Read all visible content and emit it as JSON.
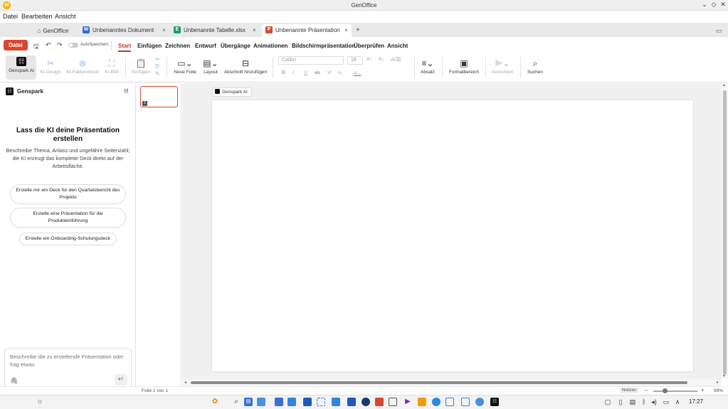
{
  "window": {
    "title": "GenOffice",
    "logo": "W",
    "controls": [
      "⌄",
      "◇",
      "✕"
    ]
  },
  "menubar": {
    "items": [
      "Datei",
      "Bearbeiten",
      "Ansicht"
    ]
  },
  "tabs": [
    {
      "label": "GenOffice",
      "icon": "home-icon",
      "glyph": "⌂"
    },
    {
      "label": "Unbenanntes Dokument",
      "icon": "word-icon",
      "glyph": "W",
      "color": "#2b6cd4"
    },
    {
      "label": "Unbenannte Tabelle.xlsx",
      "icon": "excel-icon",
      "glyph": "E",
      "color": "#1e9e5a"
    },
    {
      "label": "Unbenannte Präsentation",
      "icon": "presentation-icon",
      "glyph": "P",
      "color": "#d9472f"
    }
  ],
  "tab_close": "×",
  "new_tab": "+",
  "ribbon_tabs": {
    "file": "Datei",
    "autosave_label": "AutoSpeichern",
    "items": [
      "Start",
      "Einfügen",
      "Zeichnen",
      "Entwurf",
      "Übergänge",
      "Animationen",
      "Bildschirmpräsentation",
      "Überprüfen",
      "Ansicht"
    ],
    "active": "Start"
  },
  "ribbon": {
    "genspark_ai": "Genspark AI",
    "ki_design": "KI-Design",
    "ki_faktencheck": "KI-Faktencheck",
    "ki_bild": "KI-Bild",
    "einfuegen": "Einfügen",
    "neue_folie": "Neue Folie",
    "layout": "Layout",
    "abschnitt": "Abschnitt hinzufügen",
    "font_name": "Calibri",
    "font_size": "18",
    "absatz": "Absatz",
    "formatbereich": "Formatbereich",
    "ausrichten": "Ausrichten",
    "suchen": "Suchen"
  },
  "sidebar": {
    "title": "Genspark",
    "heading": "Lass die KI deine Präsentation erstellen",
    "description_line1": "Beschreibe Thema, Anlass und ungefähre Seitenzahl;",
    "description_line2": "die KI erzeugt das komplette Deck direkt auf der Arbeitsfläche.",
    "suggestions": [
      "Erstelle mir ein Deck für den Quartalsbericht des Projekts",
      "Erstelle eine Präsentation für die Produkteinführung",
      "Erstelle ein Onboarding-Schulungsdeck"
    ],
    "input_placeholder": "Beschreibe die zu erstellende Präsentation oder frag etwas"
  },
  "slides": {
    "thumb_number": "1",
    "chip_label": "Genspark AI"
  },
  "status": {
    "slide_count": "Folie 1 von 1",
    "notes": "Notizen",
    "zoom_minus": "–",
    "zoom_plus": "+",
    "zoom": "99%",
    "zoom_fraction": 0.25
  },
  "taskbar": {
    "time": "17:27"
  }
}
